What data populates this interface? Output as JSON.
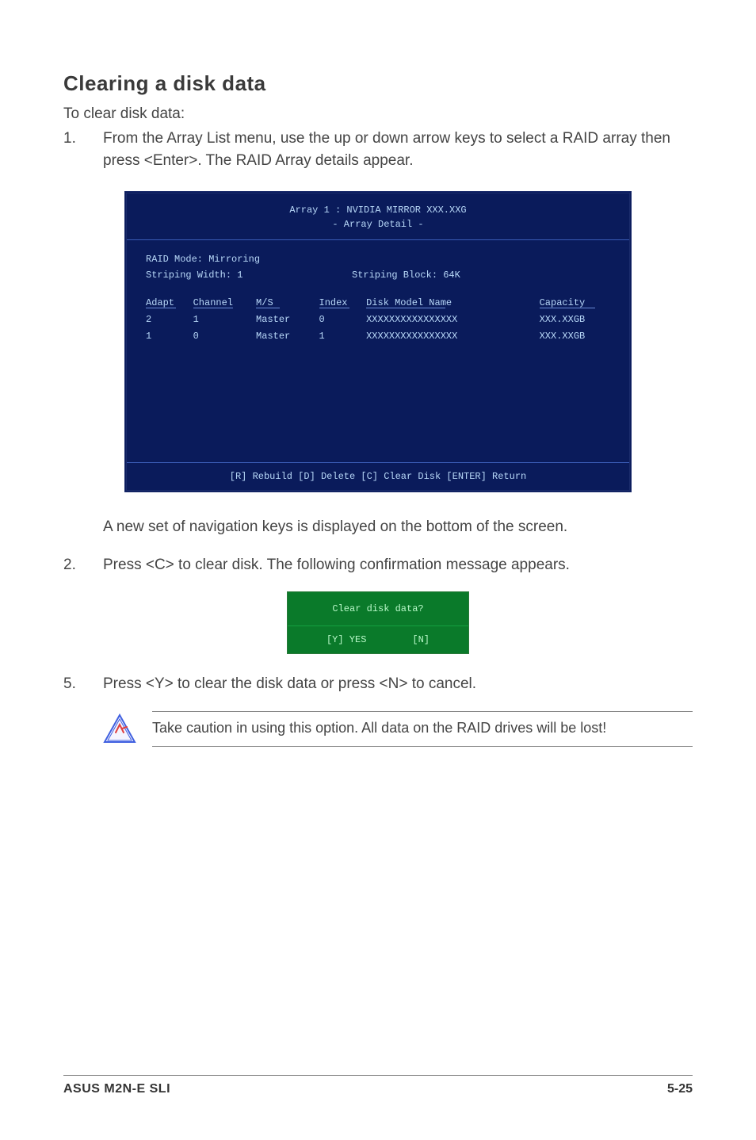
{
  "section_title": "Clearing a disk data",
  "intro": "To clear disk data:",
  "step1_num": "1.",
  "step1_text": "From the Array List menu, use the up or down arrow keys to select a RAID array then press <Enter>. The RAID Array details appear.",
  "step1b_text": "A new set of  navigation keys is displayed on the bottom of the screen.",
  "step2_num": "2.",
  "step2_text": "Press <C> to clear disk. The following confirmation message appears.",
  "step5_num": "5.",
  "step5_text": "Press <Y> to clear the disk data or press <N> to cancel.",
  "bios": {
    "header1": "Array 1 : NVIDIA MIRROR  XXX.XXG",
    "header2": "- Array Detail -",
    "raid_mode": "RAID Mode: Mirroring",
    "striping_width": "Striping Width: 1",
    "striping_block": "Striping Block: 64K",
    "head_adapt": "Adapt",
    "head_channel": "Channel",
    "head_ms": "M/S",
    "head_index": "Index",
    "head_model": "Disk Model Name",
    "head_cap": "Capacity",
    "rows": [
      {
        "adapt": "2",
        "channel": "1",
        "ms": "Master",
        "index": "0",
        "model": "XXXXXXXXXXXXXXXX",
        "cap": "XXX.XXGB"
      },
      {
        "adapt": "1",
        "channel": "0",
        "ms": "Master",
        "index": "1",
        "model": "XXXXXXXXXXXXXXXX",
        "cap": "XXX.XXGB"
      }
    ],
    "footer": "[R] Rebuild  [D] Delete  [C] Clear Disk  [ENTER] Return"
  },
  "dialog": {
    "title": "Clear disk data?",
    "yes": "[Y] YES",
    "no": "[N]"
  },
  "warning_text": "Take caution in using this option. All data on the RAID drives will be lost!",
  "footer_left": "ASUS M2N-E SLI",
  "footer_right": "5-25"
}
